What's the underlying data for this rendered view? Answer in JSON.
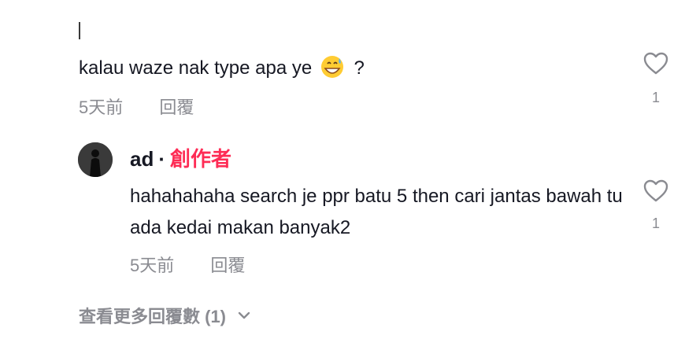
{
  "comment": {
    "text": "kalau waze nak type apa ye",
    "emoji": "grinning-sweat-emoji",
    "suffix": " ?",
    "time": "5天前",
    "reply_label": "回覆",
    "likes": "1"
  },
  "reply": {
    "author": "ad",
    "separator": "·",
    "creator_badge": "創作者",
    "text": "hahahahaha search je ppr batu 5 then cari jantas bawah tu ada kedai makan banyak2",
    "time": "5天前",
    "reply_label": "回覆",
    "likes": "1"
  },
  "view_more": {
    "label": "查看更多回覆數 (1)"
  },
  "colors": {
    "creator": "#fe2c55",
    "meta": "#8a8b91",
    "text": "#161823"
  }
}
